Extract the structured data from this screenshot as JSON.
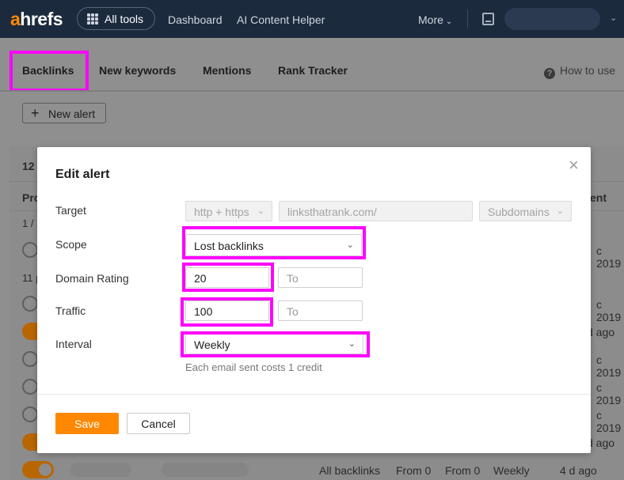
{
  "topnav": {
    "logo_a": "a",
    "logo_rest": "hrefs",
    "all_tools": "All tools",
    "links": [
      "Dashboard",
      "AI Content Helper"
    ],
    "more": "More",
    "chevron": "⌄"
  },
  "subtabs": {
    "items": [
      "Backlinks",
      "New keywords",
      "Mentions",
      "Rank Tracker"
    ],
    "how_to_use": "How to use",
    "new_alert": "New alert"
  },
  "background_list": {
    "count_fragment": "12",
    "col_left": "Pro",
    "col_right": "ent",
    "group1": "1 / 1",
    "group2": "11 p",
    "row_dates": [
      "c 2019",
      "c 2019",
      "d ago",
      "c 2019",
      "c 2019",
      "c 2019",
      "d ago"
    ],
    "last_row": {
      "type": "All backlinks",
      "from1": "From 0",
      "from2": "From 0",
      "interval": "Weekly",
      "sent": "4 d ago"
    }
  },
  "modal": {
    "title": "Edit alert",
    "close": "×",
    "target": {
      "label": "Target",
      "protocol": "http + https",
      "url": "linksthatrank.com/",
      "mode": "Subdomains"
    },
    "scope": {
      "label": "Scope",
      "value": "Lost backlinks"
    },
    "domain_rating": {
      "label": "Domain Rating",
      "from": "20",
      "to_placeholder": "To"
    },
    "traffic": {
      "label": "Traffic",
      "from": "100",
      "to_placeholder": "To"
    },
    "interval": {
      "label": "Interval",
      "value": "Weekly"
    },
    "help": "Each email sent costs 1 credit",
    "save": "Save",
    "cancel": "Cancel"
  },
  "colors": {
    "nav_bg": "#1c2a3d",
    "accent_orange": "#ff8800",
    "annotation_magenta": "#ff00ff"
  }
}
